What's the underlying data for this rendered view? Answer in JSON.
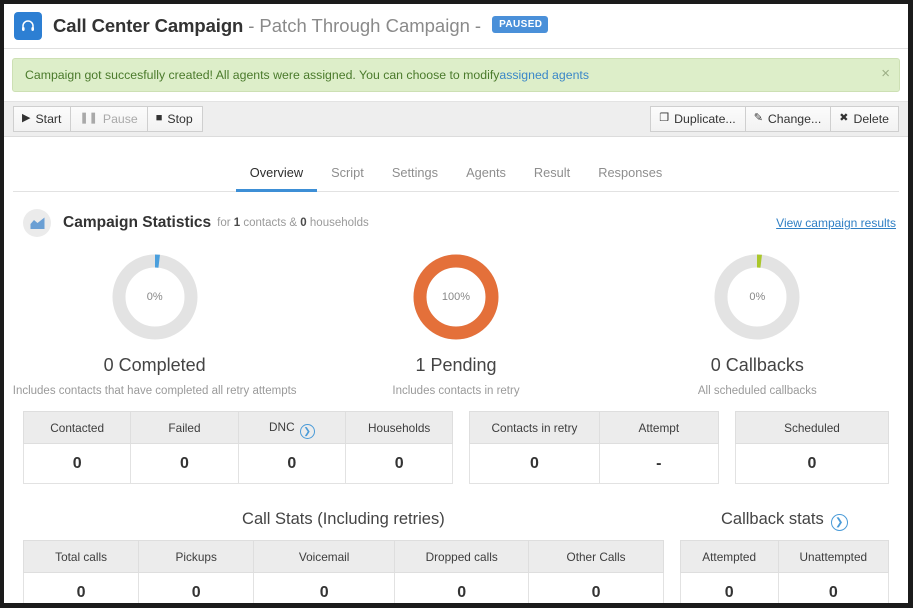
{
  "header": {
    "icon": "headset-icon",
    "title": "Call Center Campaign",
    "separator1": "-",
    "subtitle": "Patch Through Campaign",
    "separator2": "-",
    "status_badge": "PAUSED",
    "badge_color": "#4a90d9",
    "icon_bg": "#2d7fd3"
  },
  "alert": {
    "message": "Campaign got succesfully created! All agents were assigned. You can choose to modify ",
    "link_text": "assigned agents",
    "close_label": "×",
    "bg_color": "#ddeec9",
    "text_color": "#4a7a2b"
  },
  "toolbar": {
    "left_buttons": [
      {
        "label": "Start",
        "icon": "play-icon",
        "glyph": "▶",
        "disabled": false
      },
      {
        "label": "Pause",
        "icon": "pause-icon",
        "glyph": "❚❚",
        "disabled": true
      },
      {
        "label": "Stop",
        "icon": "stop-icon",
        "glyph": "■",
        "disabled": false
      }
    ],
    "right_buttons": [
      {
        "label": "Duplicate...",
        "icon": "copy-icon",
        "glyph": "❐"
      },
      {
        "label": "Change...",
        "icon": "pencil-square-icon",
        "glyph": "✎"
      },
      {
        "label": "Delete",
        "icon": "cross-icon",
        "glyph": "✖"
      }
    ]
  },
  "tabs": [
    {
      "label": "Overview",
      "active": true
    },
    {
      "label": "Script",
      "active": false
    },
    {
      "label": "Settings",
      "active": false
    },
    {
      "label": "Agents",
      "active": false
    },
    {
      "label": "Result",
      "active": false
    },
    {
      "label": "Responses",
      "active": false
    }
  ],
  "stats_header": {
    "icon": "chart-area-icon",
    "title": "Campaign Statistics",
    "for_word": "for",
    "contacts_count": "1",
    "contacts_word": "contacts &",
    "households_count": "0",
    "households_word": "households",
    "results_link": "View campaign results"
  },
  "chart_data": {
    "type": "pie",
    "title": "Campaign Statistics",
    "charts": [
      {
        "name": "Completed",
        "center_label": "0%",
        "value": 0,
        "total": 1,
        "percent": 0,
        "accent_color": "#4a9fdd",
        "track_color": "#e3e3e3",
        "heading": "0 Completed",
        "description": "Includes contacts that have completed all retry attempts"
      },
      {
        "name": "Pending",
        "center_label": "100%",
        "value": 1,
        "total": 1,
        "percent": 100,
        "accent_color": "#e4703a",
        "track_color": "#e3e3e3",
        "heading": "1 Pending",
        "description": "Includes contacts in retry"
      },
      {
        "name": "Callbacks",
        "center_label": "0%",
        "value": 0,
        "total": 1,
        "percent": 0,
        "accent_color": "#aac72a",
        "track_color": "#e3e3e3",
        "heading": "0 Callbacks",
        "description": "All scheduled callbacks"
      }
    ]
  },
  "tables": {
    "contacts": {
      "headers": [
        "Contacted",
        "Failed",
        "DNC",
        "Households"
      ],
      "header_icons": [
        null,
        null,
        "circle-arrow-right-icon",
        null
      ],
      "values": [
        "0",
        "0",
        "0",
        "0"
      ]
    },
    "retry": {
      "headers": [
        "Contacts in retry",
        "Attempt"
      ],
      "values": [
        "0",
        "-"
      ]
    },
    "scheduled": {
      "headers": [
        "Scheduled"
      ],
      "values": [
        "0"
      ]
    },
    "call_stats": {
      "section_title": "Call Stats (Including retries)",
      "headers": [
        "Total calls",
        "Pickups",
        "Voicemail",
        "Dropped calls",
        "Other Calls"
      ],
      "values": [
        "0",
        "0",
        "0",
        "0",
        "0"
      ]
    },
    "callback_stats": {
      "section_title": "Callback stats",
      "section_icon": "circle-arrow-right-icon",
      "headers": [
        "Attempted",
        "Unattempted"
      ],
      "values": [
        "0",
        "0"
      ]
    }
  }
}
